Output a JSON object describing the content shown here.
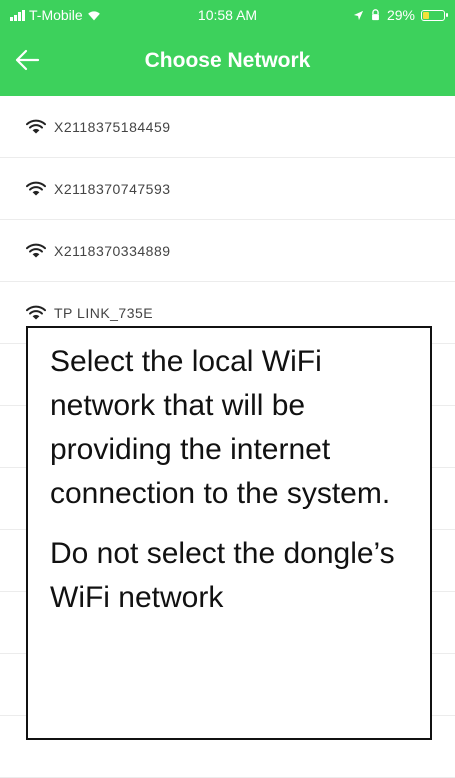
{
  "status_bar": {
    "carrier": "T-Mobile",
    "time": "10:58 AM",
    "battery": "29%"
  },
  "header": {
    "title": "Choose Network",
    "back_icon": "back-arrow-icon"
  },
  "networks": [
    {
      "name": "X2118375184459"
    },
    {
      "name": "X2118370747593"
    },
    {
      "name": "X2118370334889"
    },
    {
      "name": "TP LINK_735E"
    },
    {
      "name": ""
    },
    {
      "name": ""
    },
    {
      "name": ""
    },
    {
      "name": ""
    },
    {
      "name": ""
    },
    {
      "name": ""
    },
    {
      "name": ""
    }
  ],
  "callout": {
    "paragraph1": "Select the local WiFi network that will be providing the internet connection to the system.",
    "paragraph2": "Do not select the dongle’s WiFi network"
  },
  "colors": {
    "header_bg": "#3dd15c",
    "text": "#444444"
  }
}
